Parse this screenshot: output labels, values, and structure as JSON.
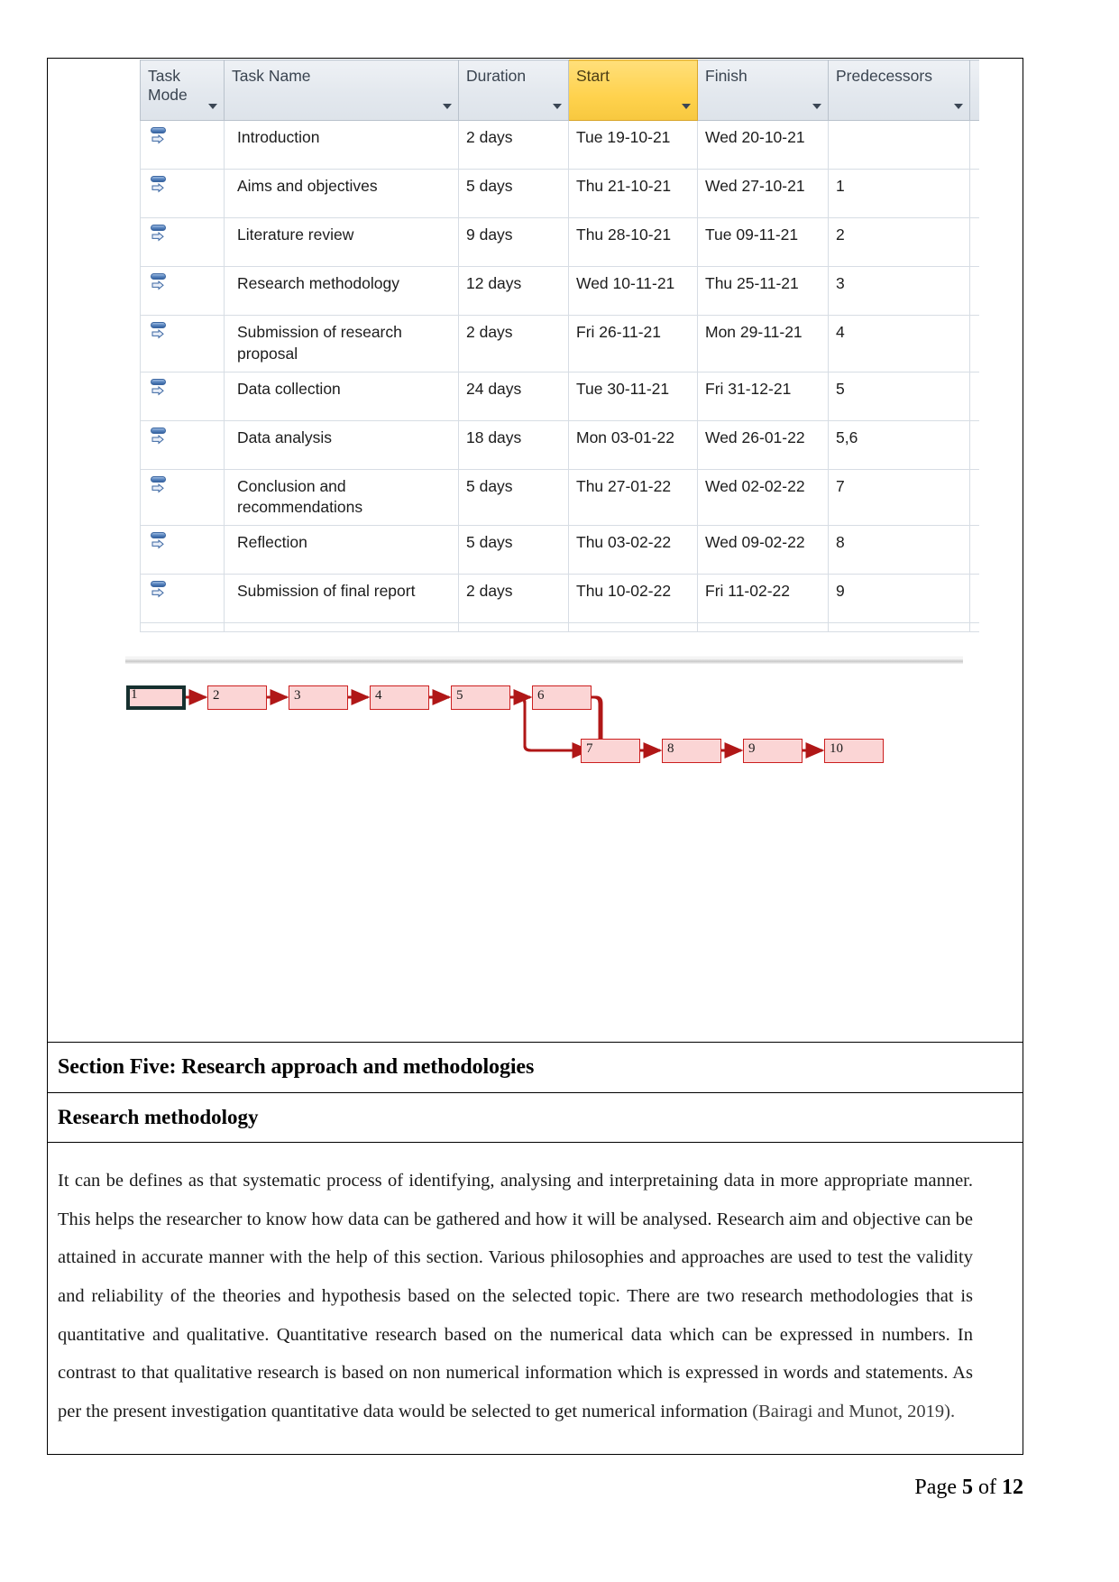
{
  "project_grid": {
    "columns": [
      {
        "key": "task_mode",
        "label": "Task Mode",
        "has_filter": true,
        "selected": false
      },
      {
        "key": "task_name",
        "label": "Task Name",
        "has_filter": true,
        "selected": false
      },
      {
        "key": "duration",
        "label": "Duration",
        "has_filter": true,
        "selected": false
      },
      {
        "key": "start",
        "label": "Start",
        "has_filter": true,
        "selected": true
      },
      {
        "key": "finish",
        "label": "Finish",
        "has_filter": true,
        "selected": false
      },
      {
        "key": "predecessors",
        "label": "Predecessors",
        "has_filter": true,
        "selected": false
      }
    ],
    "selected_column_color": "#ffd24d",
    "mode_icon_name": "auto-scheduled-icon",
    "rows": [
      {
        "id": 1,
        "mode": "auto-scheduled-icon",
        "name": "Introduction",
        "duration": "2 days",
        "start": "Tue 19-10-21",
        "finish": "Wed 20-10-21",
        "predecessors": ""
      },
      {
        "id": 2,
        "mode": "auto-scheduled-icon",
        "name": "Aims and objectives",
        "duration": "5 days",
        "start": "Thu 21-10-21",
        "finish": "Wed 27-10-21",
        "predecessors": "1"
      },
      {
        "id": 3,
        "mode": "auto-scheduled-icon",
        "name": "Literature review",
        "duration": "9 days",
        "start": "Thu 28-10-21",
        "finish": "Tue 09-11-21",
        "predecessors": "2"
      },
      {
        "id": 4,
        "mode": "auto-scheduled-icon",
        "name": "Research methodology",
        "duration": "12 days",
        "start": "Wed 10-11-21",
        "finish": "Thu 25-11-21",
        "predecessors": "3"
      },
      {
        "id": 5,
        "mode": "auto-scheduled-icon",
        "name": "Submission of research proposal",
        "duration": "2 days",
        "start": "Fri 26-11-21",
        "finish": "Mon 29-11-21",
        "predecessors": "4"
      },
      {
        "id": 6,
        "mode": "auto-scheduled-icon",
        "name": "Data collection",
        "duration": "24 days",
        "start": "Tue 30-11-21",
        "finish": "Fri 31-12-21",
        "predecessors": "5"
      },
      {
        "id": 7,
        "mode": "auto-scheduled-icon",
        "name": "Data analysis",
        "duration": "18 days",
        "start": "Mon 03-01-22",
        "finish": "Wed 26-01-22",
        "predecessors": "5,6"
      },
      {
        "id": 8,
        "mode": "auto-scheduled-icon",
        "name": "Conclusion and recommendations",
        "duration": "5 days",
        "start": "Thu 27-01-22",
        "finish": "Wed 02-02-22",
        "predecessors": "7"
      },
      {
        "id": 9,
        "mode": "auto-scheduled-icon",
        "name": "Reflection",
        "duration": "5 days",
        "start": "Thu 03-02-22",
        "finish": "Wed 09-02-22",
        "predecessors": "8"
      },
      {
        "id": 10,
        "mode": "auto-scheduled-icon",
        "name": "Submission of final report",
        "duration": "2 days",
        "start": "Thu 10-02-22",
        "finish": "Fri 11-02-22",
        "predecessors": "9"
      }
    ]
  },
  "network_diagram": {
    "node_fill": "#fbd5d5",
    "node_border": "#cc1f1f",
    "selected_node_outline": "#16302f",
    "nodes": [
      {
        "label": "1",
        "selected": true
      },
      {
        "label": "2",
        "selected": false
      },
      {
        "label": "3",
        "selected": false
      },
      {
        "label": "4",
        "selected": false
      },
      {
        "label": "5",
        "selected": false
      },
      {
        "label": "6",
        "selected": false
      },
      {
        "label": "7",
        "selected": false
      },
      {
        "label": "8",
        "selected": false
      },
      {
        "label": "9",
        "selected": false
      },
      {
        "label": "10",
        "selected": false
      }
    ],
    "links": [
      "1>2",
      "2>3",
      "3>4",
      "4>5",
      "5>6",
      "5>7",
      "6>7",
      "7>8",
      "8>9",
      "9>10"
    ]
  },
  "document": {
    "section_heading": "Section Five: Research approach and methodologies",
    "sub_heading": "Research methodology",
    "body_paragraph": "It can be defines as that systematic process of identifying, analysing and interpretaining data in more appropriate manner. This helps the researcher to know how data can be gathered and how it will be analysed. Research aim and objective can be attained in accurate manner with the help of this section. Various philosophies and approaches are used to test the validity and reliability of the theories and hypothesis based on the selected topic. There are two research methodologies that is quantitative and qualitative. Quantitative research based on the numerical data which can be expressed in numbers. In contrast to that qualitative research is based on non numerical information which is expressed in words and statements. As per the present investigation quantitative data would be selected to get numerical information ",
    "citation": "(Bairagi and Munot, 2019)."
  },
  "footer": {
    "prefix": "Page ",
    "current_page": "5",
    "middle": " of ",
    "total_pages": "12"
  }
}
